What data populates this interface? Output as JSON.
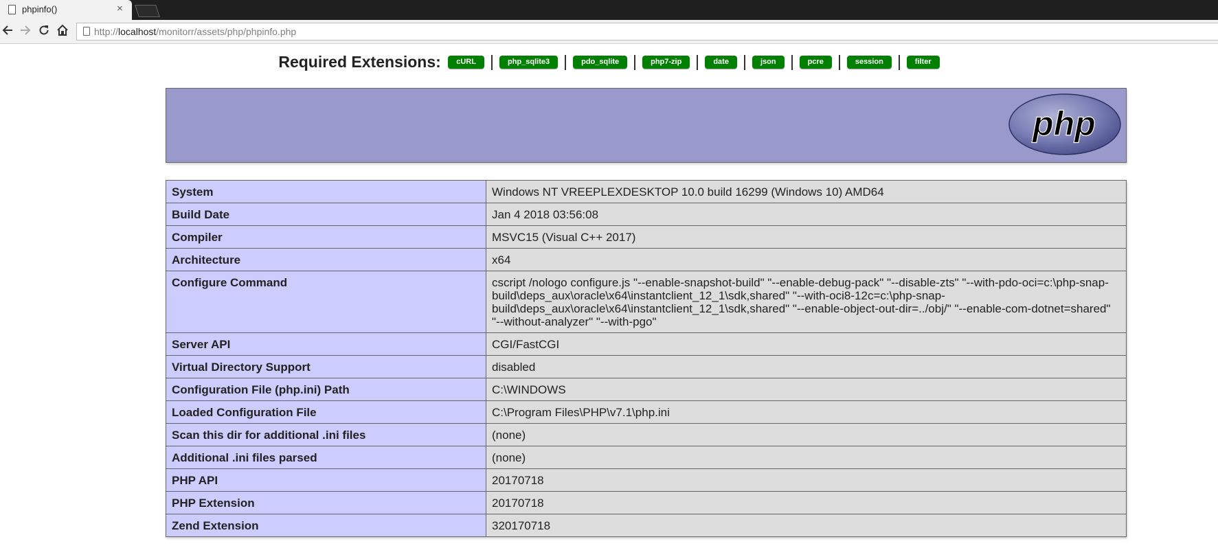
{
  "browser": {
    "tab_title": "phpinfo()",
    "tab_close": "×",
    "url_scheme": "http://",
    "url_host": "localhost",
    "url_path": "/monitorr/assets/php/phpinfo.php"
  },
  "extensions": {
    "label": "Required Extensions:",
    "items": [
      "cURL",
      "php_sqlite3",
      "pdo_sqlite",
      "php7-zip",
      "date",
      "json",
      "pcre",
      "session",
      "filter"
    ],
    "badge_color": "#008000"
  },
  "banner": {
    "logo_text": "php",
    "background": "#9999cc"
  },
  "info_rows": [
    {
      "key": "System",
      "value": "Windows NT VREEPLEXDESKTOP 10.0 build 16299 (Windows 10) AMD64"
    },
    {
      "key": "Build Date",
      "value": "Jan 4 2018 03:56:08"
    },
    {
      "key": "Compiler",
      "value": "MSVC15 (Visual C++ 2017)"
    },
    {
      "key": "Architecture",
      "value": "x64"
    },
    {
      "key": "Configure Command",
      "value": "cscript /nologo configure.js \"--enable-snapshot-build\" \"--enable-debug-pack\" \"--disable-zts\" \"--with-pdo-oci=c:\\php-snap-build\\deps_aux\\oracle\\x64\\instantclient_12_1\\sdk,shared\" \"--with-oci8-12c=c:\\php-snap-build\\deps_aux\\oracle\\x64\\instantclient_12_1\\sdk,shared\" \"--enable-object-out-dir=../obj/\" \"--enable-com-dotnet=shared\" \"--without-analyzer\" \"--with-pgo\""
    },
    {
      "key": "Server API",
      "value": "CGI/FastCGI"
    },
    {
      "key": "Virtual Directory Support",
      "value": "disabled"
    },
    {
      "key": "Configuration File (php.ini) Path",
      "value": "C:\\WINDOWS"
    },
    {
      "key": "Loaded Configuration File",
      "value": "C:\\Program Files\\PHP\\v7.1\\php.ini"
    },
    {
      "key": "Scan this dir for additional .ini files",
      "value": "(none)"
    },
    {
      "key": "Additional .ini files parsed",
      "value": "(none)"
    },
    {
      "key": "PHP API",
      "value": "20170718"
    },
    {
      "key": "PHP Extension",
      "value": "20170718"
    },
    {
      "key": "Zend Extension",
      "value": "320170718"
    }
  ]
}
